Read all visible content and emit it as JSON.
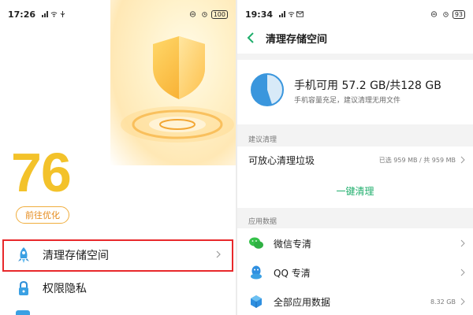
{
  "left": {
    "status": {
      "time": "17:26",
      "battery": "100"
    },
    "score": "76",
    "optimize_button": "前往优化",
    "rows": [
      {
        "label": "清理存储空间",
        "icon": "rocket-icon"
      },
      {
        "label": "权限隐私",
        "icon": "lock-icon"
      }
    ]
  },
  "right": {
    "status": {
      "time": "19:34",
      "battery": "93"
    },
    "header": {
      "title": "清理存储空间",
      "back_icon": "back-arrow-icon"
    },
    "storage": {
      "main": "手机可用 57.2 GB/共128 GB",
      "sub": "手机容量充足，建议清理无用文件",
      "used_fraction": 0.55
    },
    "sections": [
      {
        "title": "建议清理",
        "rows": [
          {
            "label": "可放心清理垃圾",
            "meta": "已选 959 MB / 共 959 MB"
          }
        ],
        "action": "一键清理"
      },
      {
        "title": "应用数据",
        "rows": [
          {
            "label": "微信专清",
            "icon": "wechat-icon",
            "meta": ""
          },
          {
            "label": "QQ 专清",
            "icon": "qq-penguin-icon",
            "meta": ""
          },
          {
            "label": "全部应用数据",
            "icon": "app-cube-icon",
            "meta": "8.32 GB"
          }
        ]
      }
    ]
  },
  "colors": {
    "score": "#f3c22a",
    "optimize": "#e58a1a",
    "highlight": "#e8282b",
    "accent_green": "#1fae6c",
    "back_arrow": "#1fae6c",
    "gauge": "#3a96dd"
  }
}
